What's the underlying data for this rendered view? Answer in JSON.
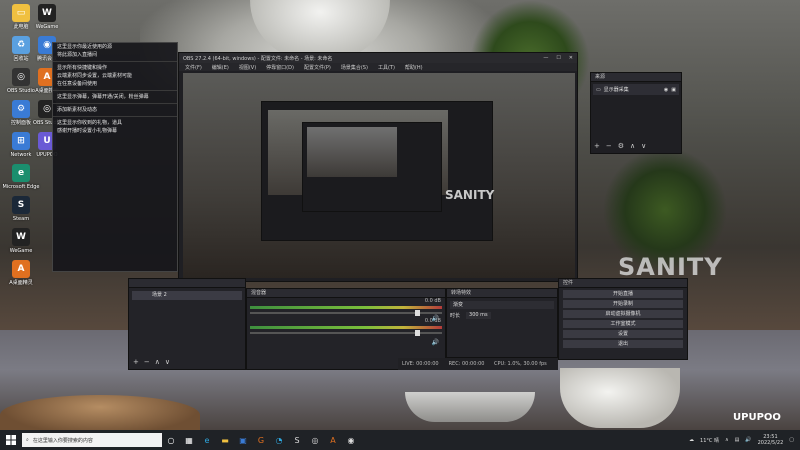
{
  "desktop": {
    "icons": [
      {
        "label": "此电脑",
        "color": "#f0c040",
        "glyph": "▭"
      },
      {
        "label": "回收站",
        "color": "#5aa0e0",
        "glyph": "♻"
      },
      {
        "label": "OBS Studio",
        "color": "#333",
        "glyph": "◎"
      },
      {
        "label": "控制面板",
        "color": "#3a7bd5",
        "glyph": "⚙"
      },
      {
        "label": "Network",
        "color": "#3a7bd5",
        "glyph": "⊞"
      },
      {
        "label": "Microsoft Edge",
        "color": "#1b8e6e",
        "glyph": "e"
      },
      {
        "label": "Steam",
        "color": "#1b2838",
        "glyph": "S"
      },
      {
        "label": "WeGame",
        "color": "#222",
        "glyph": "W"
      },
      {
        "label": "A桌面精灵",
        "color": "#e07020",
        "glyph": "A"
      }
    ],
    "icons_col2": [
      {
        "label": "WeGame",
        "color": "#222",
        "glyph": "W"
      },
      {
        "label": "腾讯会议",
        "color": "#3a7bd5",
        "glyph": "◉"
      },
      {
        "label": "A桌面搜索",
        "color": "#e07020",
        "glyph": "A"
      },
      {
        "label": "OBS Studio",
        "color": "#222",
        "glyph": "◎"
      },
      {
        "label": "UPUPOO",
        "color": "#6a5ad5",
        "glyph": "U"
      }
    ],
    "watermark": "SANITY",
    "brand": "UPUPOO"
  },
  "hint_menu": {
    "items": [
      "这里显示你最近使用的源",
      "将此源加入直播间",
      "",
      "显示所有快捷键和操作",
      "云端素材同步设置，云端素材可能",
      "在任意设备间使用",
      "",
      "这里显示弹幕，弹幕开通/关闭，粉丝弹幕",
      "",
      "添加新素材及动态",
      "",
      "这里显示你收到的礼物，道具",
      "感谢开播时设置小礼物弹幕"
    ]
  },
  "obs": {
    "title": "OBS 27.2.4 (64-bit, windows) - 配置文件: 未命名 - 场景: 未命名",
    "menu": [
      "文件(F)",
      "编辑(E)",
      "视图(V)",
      "停靠窗口(D)",
      "配置文件(P)",
      "场景集合(S)",
      "工具(T)",
      "帮助(H)"
    ],
    "preview_watermark": "SANITY"
  },
  "docks": {
    "scenes": {
      "title": "",
      "items": [
        "场景 2"
      ]
    },
    "mixer": {
      "title": "混音器",
      "ch1_db": "0.0 dB",
      "ch2_db": "0.0 dB"
    },
    "transitions": {
      "title": "转场特效",
      "fade": "渐变",
      "duration_label": "时长",
      "duration_value": "300 ms"
    },
    "controls": {
      "title": "控件",
      "buttons": [
        "开始直播",
        "开始录制",
        "启动虚拟摄像机",
        "工作室模式",
        "设置",
        "退出"
      ]
    },
    "sources": {
      "title": "来源",
      "item": "显示器采集",
      "toolbar": [
        "+",
        "−",
        "⚙",
        "∧",
        "∨"
      ]
    }
  },
  "status": {
    "live": "LIVE: 00:00:00",
    "rec": "REC: 00:00:00",
    "cpu": "CPU: 1.0%, 30.00 fps"
  },
  "taskbar": {
    "search_placeholder": "在这里输入你要搜索的内容",
    "weather": "11°C 晴",
    "time": "23:51",
    "date": "2022/5/22"
  }
}
